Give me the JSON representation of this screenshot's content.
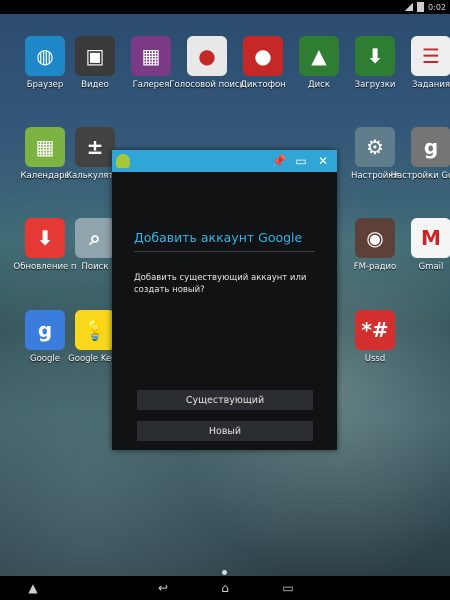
{
  "statusbar": {
    "time": "0:02"
  },
  "apps": [
    {
      "label": "Браузер",
      "icon": "globe-icon",
      "color": "#1e88c8"
    },
    {
      "label": "Видео",
      "icon": "film-icon",
      "color": "#3a3a3a"
    },
    {
      "label": "Галерея",
      "icon": "gallery-icon",
      "color": "#7b3a86"
    },
    {
      "label": "Голосовой поиск",
      "icon": "mic-icon",
      "color": "#e8e8e8"
    },
    {
      "label": "Диктофон",
      "icon": "recorder-icon",
      "color": "#c62828"
    },
    {
      "label": "Диск",
      "icon": "drive-icon",
      "color": "#2e7d32"
    },
    {
      "label": "Загрузки",
      "icon": "download-icon",
      "color": "#2e7d32"
    },
    {
      "label": "Задания",
      "icon": "tasks-icon",
      "color": "#eeeeee"
    },
    {
      "label": "Календарь",
      "icon": "calendar-icon",
      "color": "#7cb342"
    },
    {
      "label": "Калькулятор",
      "icon": "calculator-icon",
      "color": "#424242"
    },
    {
      "label": "Настройки",
      "icon": "settings-gear-icon",
      "color": "#607d8b"
    },
    {
      "label": "Настройки Google",
      "icon": "google-settings-icon",
      "color": "#757575"
    },
    {
      "label": "Обновление п",
      "icon": "update-icon",
      "color": "#e53935"
    },
    {
      "label": "Поиск",
      "icon": "search-icon",
      "color": "#90a4ae"
    },
    {
      "label": "FM-радио",
      "icon": "radio-icon",
      "color": "#5d4037"
    },
    {
      "label": "Gmail",
      "icon": "gmail-icon",
      "color": "#f5f5f5"
    },
    {
      "label": "Google",
      "icon": "google-search-icon",
      "color": "#3b7ddd"
    },
    {
      "label": "Google Keep",
      "icon": "keep-icon",
      "color": "#f9d71c"
    },
    {
      "label": "Ussd",
      "icon": "ussd-icon",
      "color": "#d32f2f"
    }
  ],
  "dialog": {
    "heading": "Добавить аккаунт Google",
    "description": "Добавить существующий аккаунт или создать новый?",
    "existing_button": "Существующий",
    "new_button": "Новый",
    "titlebar_color": "#2fa6d6"
  },
  "navbar": {
    "up": "▲",
    "back": "↩",
    "home": "⌂",
    "recents": "▭"
  }
}
